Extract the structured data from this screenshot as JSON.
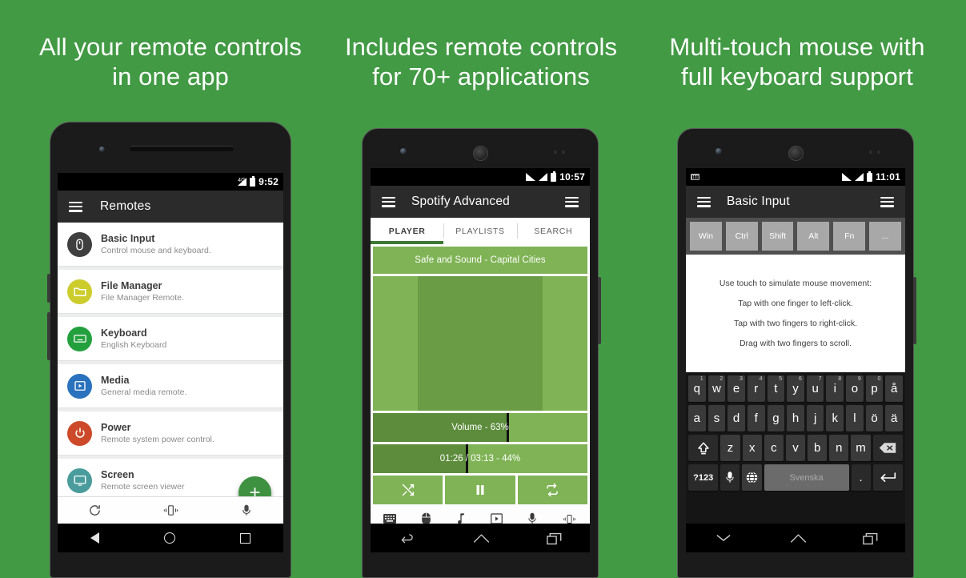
{
  "page": {
    "background_color": "#429a44",
    "accent_green": "#3d9140",
    "light_green": "#7fb355",
    "dark_green": "#5d8c3c"
  },
  "headlines": [
    {
      "line1": "All your remote controls",
      "line2": "in one app"
    },
    {
      "line1": "Includes remote controls",
      "line2": "for 70+ applications"
    },
    {
      "line1": "Multi-touch mouse with",
      "line2": "full keyboard support"
    }
  ],
  "phone1": {
    "status": {
      "network": "4G",
      "clock": "9:52"
    },
    "appbar": {
      "title": "Remotes",
      "menu_icon": "hamburger-icon"
    },
    "list": [
      {
        "title": "Basic Input",
        "subtitle": "Control mouse and keyboard.",
        "icon": "mouse-icon",
        "color": "#3f3f3f"
      },
      {
        "title": "File Manager",
        "subtitle": "File Manager Remote.",
        "icon": "folder-icon",
        "color": "#cdcc2d"
      },
      {
        "title": "Keyboard",
        "subtitle": "English Keyboard",
        "icon": "keyboard-icon",
        "color": "#23a03e"
      },
      {
        "title": "Media",
        "subtitle": "General media remote.",
        "icon": "media-play-icon",
        "color": "#2a72bd"
      },
      {
        "title": "Power",
        "subtitle": "Remote system power control.",
        "icon": "power-icon",
        "color": "#cc4a2a"
      },
      {
        "title": "Screen",
        "subtitle": "Remote screen viewer",
        "icon": "monitor-icon",
        "color": "#4a9c9c"
      }
    ],
    "fab_label": "+",
    "bottombar": [
      "refresh-icon",
      "vibrate-icon",
      "microphone-icon"
    ],
    "navbar": [
      "back-triangle-icon",
      "home-circle-icon",
      "recents-square-icon"
    ]
  },
  "phone2": {
    "status": {
      "clock": "10:57"
    },
    "appbar": {
      "title": "Spotify Advanced",
      "menu_icon": "hamburger-icon",
      "overflow_icon": "hamburger-icon"
    },
    "tabs": [
      {
        "label": "PLAYER",
        "active": true
      },
      {
        "label": "PLAYLISTS",
        "active": false
      },
      {
        "label": "SEARCH",
        "active": false
      }
    ],
    "now_playing": "Safe and Sound - Capital Cities",
    "volume": {
      "label": "Volume - 63%",
      "percent": 63
    },
    "seek": {
      "label": "01:26 / 03:13 - 44%",
      "percent": 44,
      "elapsed": "01:26",
      "duration": "03:13"
    },
    "controls": [
      "shuffle-icon",
      "pause-icon",
      "repeat-icon"
    ],
    "toolbar": [
      "keyboard-icon",
      "mouse-icon",
      "music-note-icon",
      "media-play-icon",
      "microphone-icon",
      "vibrate-icon"
    ],
    "navbar": [
      "back-arrow-icon",
      "home-icon",
      "recents-icon"
    ]
  },
  "phone3": {
    "status": {
      "clock": "11:01",
      "left_icon": "keyboard-notification-icon"
    },
    "appbar": {
      "title": "Basic Input",
      "menu_icon": "hamburger-icon",
      "overflow_icon": "hamburger-icon"
    },
    "modifiers": [
      "Win",
      "Ctrl",
      "Shift",
      "Alt",
      "Fn",
      "..."
    ],
    "touchpad_hints": [
      "Use touch to simulate mouse movement:",
      "Tap with one finger to left-click.",
      "Tap with two fingers to right-click.",
      "Drag with two fingers to scroll."
    ],
    "keyboard": {
      "row1": [
        {
          "key": "q",
          "num": "1"
        },
        {
          "key": "w",
          "num": "2"
        },
        {
          "key": "e",
          "num": "3"
        },
        {
          "key": "r",
          "num": "4"
        },
        {
          "key": "t",
          "num": "5"
        },
        {
          "key": "y",
          "num": "6"
        },
        {
          "key": "u",
          "num": "7"
        },
        {
          "key": "i",
          "num": "8"
        },
        {
          "key": "o",
          "num": "9"
        },
        {
          "key": "p",
          "num": "0"
        },
        {
          "key": "å",
          "num": ""
        }
      ],
      "row2": [
        "a",
        "s",
        "d",
        "f",
        "g",
        "h",
        "j",
        "k",
        "l",
        "ö",
        "ä"
      ],
      "row3": {
        "shift": "shift-arrow-icon",
        "keys": [
          "z",
          "x",
          "c",
          "v",
          "b",
          "n",
          "m"
        ],
        "backspace": "backspace-icon"
      },
      "row4": {
        "symbols": "?123",
        "mic": "microphone-icon",
        "globe": "globe-icon",
        "space_label": "Svenska",
        "period": ".",
        "enter": "enter-arrow-icon"
      }
    },
    "navbar": [
      "keyboard-dismiss-chevron-icon",
      "home-icon",
      "recents-icon"
    ]
  }
}
